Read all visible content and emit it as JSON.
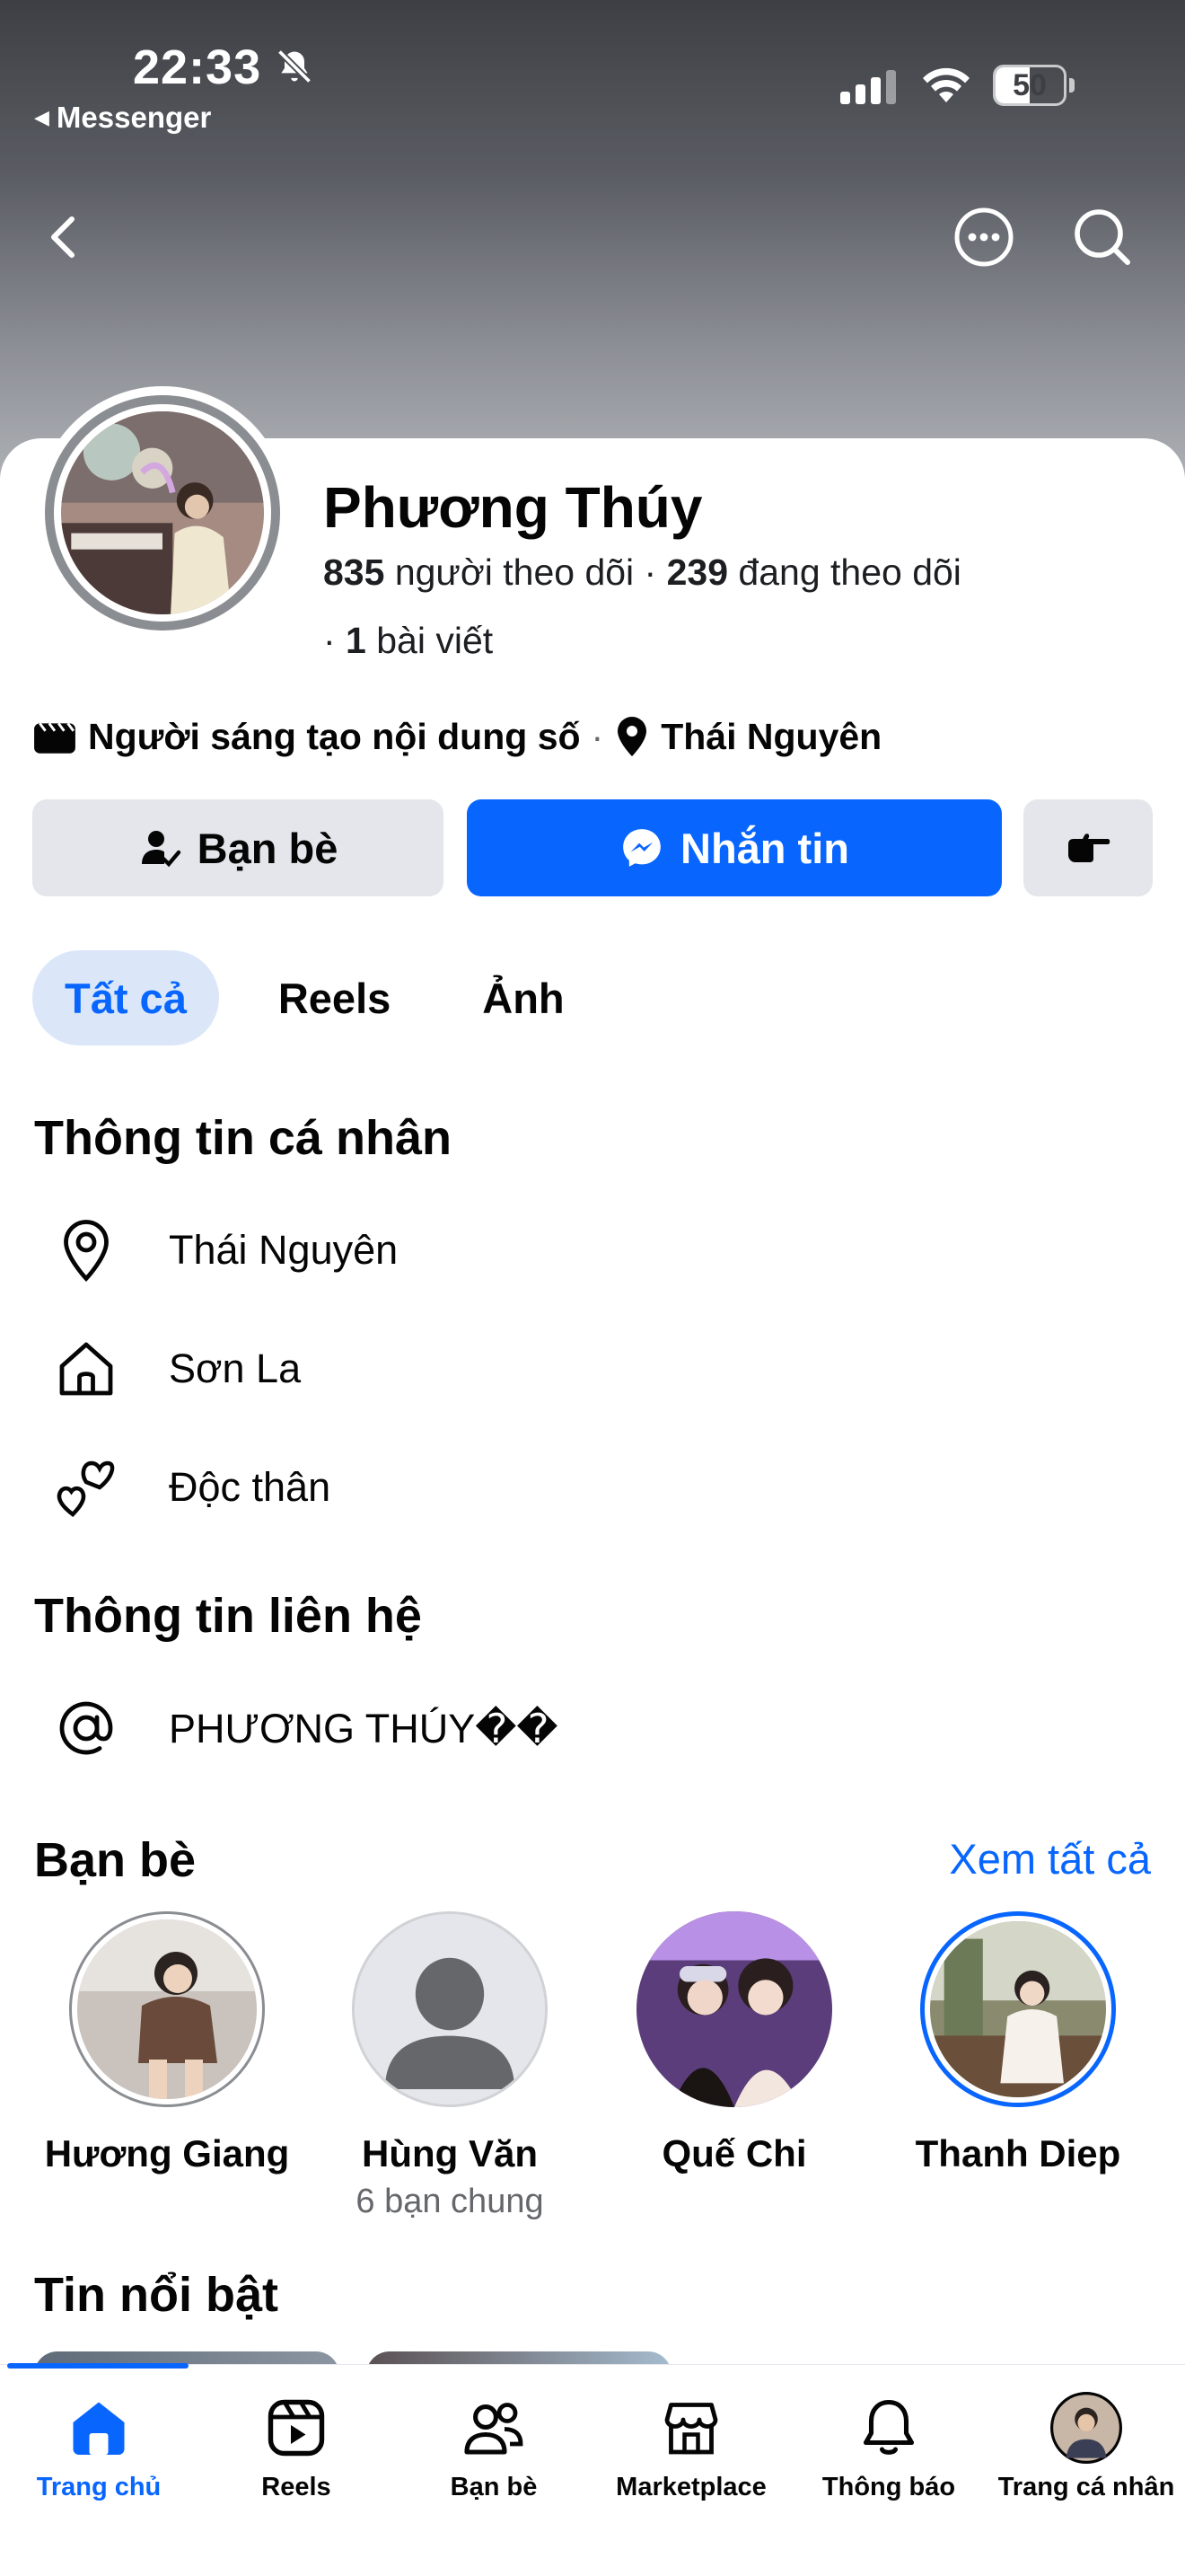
{
  "status_bar": {
    "time": "22:33",
    "back_app": "Messenger",
    "battery": "50",
    "battery_level": 0.5
  },
  "icons": {
    "nav_back": "chevron-left-icon",
    "nav_more": "more-horizontal-icon",
    "nav_search": "search-icon"
  },
  "profile": {
    "name": "Phương Thúy",
    "followers_count": "835",
    "followers_label": " người theo dõi · ",
    "following_count": "239",
    "following_label": " đang theo dõi",
    "posts_prefix": "· ",
    "posts_count": "1",
    "posts_label": " bài viết",
    "category": "Người sáng tạo nội dung số",
    "separator": "·",
    "location": "Thái Nguyên"
  },
  "actions": {
    "friends_label": "Bạn bè",
    "message_label": "Nhắn tin"
  },
  "tabs": [
    {
      "label": "Tất cả",
      "active": true
    },
    {
      "label": "Reels",
      "active": false
    },
    {
      "label": "Ảnh",
      "active": false
    }
  ],
  "personal_info": {
    "title": "Thông tin cá nhân",
    "items": [
      {
        "icon": "location-pin-icon",
        "text": "Thái Nguyên"
      },
      {
        "icon": "home-icon",
        "text": "Sơn La"
      },
      {
        "icon": "hearts-icon",
        "text": "Độc thân"
      }
    ]
  },
  "contact_info": {
    "title": "Thông tin liên hệ",
    "items": [
      {
        "icon": "at-sign-icon",
        "text": "PHƯƠNG THÚY��"
      }
    ]
  },
  "friends": {
    "title": "Bạn bè",
    "see_all": "Xem tất cả",
    "items": [
      {
        "name": "Hương Giang",
        "mutual": ""
      },
      {
        "name": "Hùng Văn",
        "mutual": "6 bạn chung"
      },
      {
        "name": "Quế Chi",
        "mutual": ""
      },
      {
        "name": "Thanh Diep",
        "mutual": ""
      }
    ]
  },
  "highlights": {
    "title": "Tin nổi bật"
  },
  "bottom_nav": [
    {
      "label": "Trang chủ",
      "icon": "home-icon",
      "active": true
    },
    {
      "label": "Reels",
      "icon": "reels-icon",
      "active": false
    },
    {
      "label": "Bạn bè",
      "icon": "friends-icon",
      "active": false
    },
    {
      "label": "Marketplace",
      "icon": "marketplace-icon",
      "active": false
    },
    {
      "label": "Thông báo",
      "icon": "bell-icon",
      "active": false
    },
    {
      "label": "Trang cá nhân",
      "icon": "profile-avatar",
      "active": false
    }
  ],
  "colors": {
    "accent": "#0866ff",
    "button_gray": "#e4e6eb",
    "secondary_text": "#65676b"
  }
}
